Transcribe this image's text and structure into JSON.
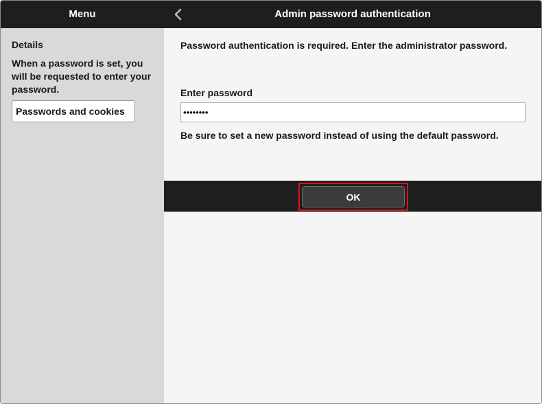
{
  "header": {
    "menu_title": "Menu",
    "back_icon": "chevron-left-icon",
    "page_title": "Admin password authentication"
  },
  "sidebar": {
    "details_heading": "Details",
    "details_text": "When a password is set, you will be requested to enter your password.",
    "link_label": "Passwords and cookies"
  },
  "main": {
    "instruction": "Password authentication is required. Enter the administrator password.",
    "field_label": "Enter password",
    "password_value": "••••••••",
    "note": "Be sure to set a new password instead of using the default password."
  },
  "actions": {
    "ok_label": "OK",
    "highlight_color": "#d9141a"
  },
  "colors": {
    "bar": "#1e1e1e",
    "sidebar": "#d9d9d9",
    "content": "#f5f5f5"
  }
}
